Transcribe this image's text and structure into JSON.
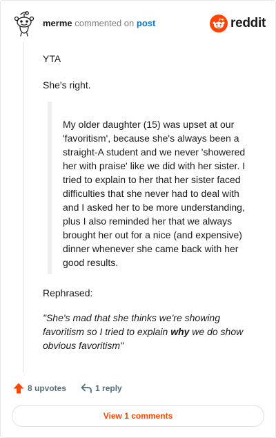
{
  "header": {
    "username": "merme",
    "verb": "commented on",
    "post_link": "post",
    "brand": "reddit"
  },
  "comment": {
    "paragraph1": "YTA",
    "paragraph2": "She's right.",
    "quote": "My older daughter (15) was upset at our 'favoritism', because she's always been a straight-A student and we never 'showered her with praise' like we did with her sister. I tried to explain to her that her sister faced difficulties that she never had to deal with and I asked her to be more understanding, plus I also reminded her that we always brought her out for a nice (and expensive) dinner whenever she came back with her good results.",
    "paragraph3": "Rephrased:",
    "rephrased_before": "\"She's mad that she thinks we're showing favoritism so I tried to explain ",
    "rephrased_bold": "why",
    "rephrased_after": " we do show obvious favoritism\""
  },
  "actions": {
    "upvotes_label": "8 upvotes",
    "reply_label": "1 reply",
    "view_comments_label": "View 1 comments"
  },
  "colors": {
    "brand": "#ff4500",
    "link": "#0079d3",
    "muted": "#7c7c7c"
  },
  "icons": {
    "avatar": "snoo-avatar-icon",
    "logo": "reddit-logo-icon",
    "upvote": "upvote-arrow-icon",
    "reply": "reply-arrow-icon"
  }
}
